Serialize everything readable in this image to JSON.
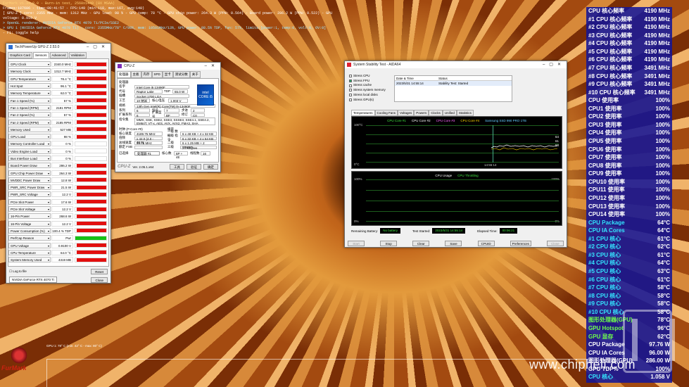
{
  "furmark": {
    "header_lines": [
      "FurMark v1.34.0.0 - Burn-in test, 2560x1440 (8X MSAA)",
      "Frames:187606 - time:00:41:57 - FPS:149 (min:118, max:167, avg:140)",
      "[ GPU-Z ] core: 2355 MHz - mem: 1312 MHz - GPU load: 98 % - GPU temp: 78 °C - GPU chip power: 264.3 W (PPW: 0.564) - Board power: 286.2 W (PPW: 0.522) - GPU voltage: 0.910 V",
      "> OpenGL renderer: NVIDIA GeForce RTX 4070 Ti/PCIe/SSE2",
      "> GPU 1 (NVIDIA GeForce RTX 4070 Ti) - core: 2355MHz/78° C/98%, mem: 10501MHz/13%, GPU power: 88.5% TDP, fan: 57%, limits:[power:1, temp:0, volt:0, OV:0]",
      "- F1: toggle help"
    ],
    "graph_label": "GPU 1: 78° C (min: 42° C - max: 80° C)",
    "logo_text": "FurMark"
  },
  "gpuz": {
    "title": "TechPowerUp GPU-Z 2.53.0",
    "tabs": [
      "Graphics Card",
      "Sensors",
      "Advanced",
      "Validation"
    ],
    "active_tab": "Sensors",
    "sensors": [
      {
        "name": "GPU Clock",
        "value": "2340.0 MHz",
        "fill": 0.95
      },
      {
        "name": "Memory Clock",
        "value": "1312.7 MHz",
        "fill": 0.95
      },
      {
        "name": "GPU Temperature",
        "value": "78.4 °C",
        "fill": 0.95
      },
      {
        "name": "Hot Spot",
        "value": "96.1 °C",
        "fill": 0.95
      },
      {
        "name": "Memory Temperature",
        "value": "62.0 °C",
        "fill": 0.95
      },
      {
        "name": "Fan 1 Speed (%)",
        "value": "57 %",
        "fill": 0.95
      },
      {
        "name": "Fan 1 Speed (RPM)",
        "value": "2181 RPM",
        "fill": 0.95
      },
      {
        "name": "Fan 2 Speed (%)",
        "value": "57 %",
        "fill": 0.95
      },
      {
        "name": "Fan 2 Speed (RPM)",
        "value": "2185 RPM",
        "fill": 0.95
      },
      {
        "name": "Memory Used",
        "value": "527 MB",
        "fill": 0.95
      },
      {
        "name": "GPU Load",
        "value": "98 %",
        "fill": 0.95
      },
      {
        "name": "Memory Controller Load",
        "value": "0 %",
        "fill": 0
      },
      {
        "name": "Video Engine Load",
        "value": "0 %",
        "fill": 0
      },
      {
        "name": "Bus Interface Load",
        "value": "0 %",
        "fill": 0
      },
      {
        "name": "Board Power Draw",
        "value": "286.2 W",
        "fill": 0.95
      },
      {
        "name": "GPU Chip Power Draw",
        "value": "264.3 W",
        "fill": 0.95
      },
      {
        "name": "MVDDC Power Draw",
        "value": "12.8 W",
        "fill": 0.95
      },
      {
        "name": "PWR_SRC Power Draw",
        "value": "21.5 W",
        "fill": 0.95
      },
      {
        "name": "PWR_SRC Voltage",
        "value": "12.2 V",
        "fill": 0.95
      },
      {
        "name": "PCIe Slot Power",
        "value": "17.6 W",
        "fill": 0.95
      },
      {
        "name": "PCIe Slot Voltage",
        "value": "12.2 V",
        "fill": 0.95
      },
      {
        "name": "16-Pin Power",
        "value": "268.6 W",
        "fill": 0.95
      },
      {
        "name": "16-Pin Voltage",
        "value": "12.2 V",
        "fill": 0.95
      },
      {
        "name": "Power Consumption (%)",
        "value": "100.4 % TDP",
        "fill": 0.95
      },
      {
        "name": "PerfCap Reason",
        "value": "Pwr",
        "fill": 1.0,
        "status": "green"
      },
      {
        "name": "GPU Voltage",
        "value": "0.9100 V",
        "fill": 0.95
      },
      {
        "name": "CPU Temperature",
        "value": "64.0 °C",
        "fill": 0.95
      },
      {
        "name": "System Memory Used",
        "value": "4319 MB",
        "fill": 0.95
      }
    ],
    "log_label": "Log to file",
    "reset_label": "Reset",
    "gpu_select": "NVIDIA GeForce RTX 4070 Ti",
    "close_label": "Close"
  },
  "cpuz": {
    "title": "CPU-Z",
    "tabs": [
      "处理器",
      "主板",
      "内存",
      "SPD",
      "显卡",
      "测试分数",
      "关于"
    ],
    "section_label": "处理器",
    "name_label": "名字",
    "name_value": "Intel Core i5 13490F",
    "codename_label": "代号",
    "codename_value": "Raptor Lake",
    "tdp_label": "TDP",
    "tdp_value": "65.0 W",
    "socket_label": "插槽",
    "socket_value": "Socket 1700 LGA",
    "tech_label": "工艺",
    "tech_value": "10 纳米",
    "vcore_label": "核心电压",
    "vcore_value": "1.003 V",
    "spec_label": "规格",
    "spec_value": "13th Gen Intel(R) Core(TM) i5-13490F",
    "family_label": "系列",
    "family_value": "6",
    "model_label": "型号",
    "model_value": "7",
    "stepping_label": "步进",
    "stepping_value": "2",
    "extfamily_label": "扩展系列",
    "extfamily_value": "6",
    "extmodel_label": "扩展型号",
    "extmodel_value": "BF",
    "revision_label": "修订",
    "revision_value": "C0",
    "instr_label": "指令集",
    "instr_value": "MMX, SSE, SSE2, SSE3, SSSE3, SSE4.1, SSE4.2, EM64T, VT-x, AES, AVX, AVX2, FMA3, SHA",
    "clocks_label": "时钟 (P-Core #0)",
    "corespeed_label": "核心速度",
    "corespeed_value": "4189.75 MHz",
    "mult_label": "倍频",
    "mult_value": "x 42.0 (4.0 - 46.0)",
    "bus_label": "总线速度",
    "bus_value": "99.76 MHz",
    "fsb_label": "额定 FSB",
    "cache_label": "缓存",
    "l1d_label": "一级 数据",
    "l1d_value": "6 x 48 KB + 4 x 32 KB",
    "l1i_label": "一级 指令",
    "l1i_value": "6 x 32 KB + 4 x 64 KB",
    "l2_label": "二级",
    "l2_value": "6 x 1.25 MB + 2 MBytes",
    "l3_label": "三级",
    "l3_value": "24 MBytes",
    "selected_label": "已选择",
    "selected_value": "处理器 #1",
    "cores_label": "核心数",
    "cores_value": "6P + 4E",
    "threads_label": "线程数",
    "threads_value": "16",
    "brand": "CPU-Z",
    "version": "Ver. 2.05.1.x64",
    "tools_label": "工具",
    "validate_label": "验证",
    "ok_label": "确定",
    "logo_text": "intel CORE i5"
  },
  "aida": {
    "title": "System Stability Test - AIDA64",
    "checks": [
      {
        "label": "Stress CPU",
        "checked": false
      },
      {
        "label": "Stress FPU",
        "checked": true
      },
      {
        "label": "Stress cache",
        "checked": false
      },
      {
        "label": "Stress system memory",
        "checked": false
      },
      {
        "label": "Stress local disks",
        "checked": false
      },
      {
        "label": "Stress GPU(s)",
        "checked": false
      }
    ],
    "info_headers": [
      "Date & Time",
      "Status"
    ],
    "info_row": [
      "2023/5/31 14:55:14",
      "Stability Test: Started"
    ],
    "tabs": [
      "Temperatures",
      "Cooling Fans",
      "Voltages",
      "Powers",
      "Clocks",
      "Unified",
      "Statistics"
    ],
    "active_tab": "Temperatures",
    "temp_legend": [
      "CPU Core #1",
      "CPU Core #2",
      "CPU Core #3",
      "CPU Core #4",
      "Samsung SSD 990 PRO 1TB"
    ],
    "temp_ymax": "100°C",
    "temp_ymin": "0°C",
    "temp_time": "14:55:14",
    "temp_readouts": [
      "64",
      "61",
      "58"
    ],
    "usage_legend_a": "CPU Usage",
    "usage_legend_b": "CPU Throttling",
    "usage_ymax": "100%",
    "usage_ymin": "0%",
    "usage_rmax": "100%",
    "usage_rmin": "0%",
    "battery_label": "Remaining Battery:",
    "battery_value": "No battery",
    "started_label": "Test Started:",
    "started_value": "2023/5/31 14:55:14",
    "elapsed_label": "Elapsed Time:",
    "elapsed_value": "00:06:21",
    "buttons": [
      "Start",
      "Stop",
      "Clear",
      "Save",
      "CPUID",
      "Preferences",
      "Close"
    ]
  },
  "osd": {
    "rows": [
      {
        "k": "CPU 核心频率",
        "v": "4190 MHz",
        "c": "white"
      },
      {
        "k": "#1 CPU 核心频率",
        "v": "4190 MHz",
        "c": "white"
      },
      {
        "k": "#2 CPU 核心频率",
        "v": "4190 MHz",
        "c": "white"
      },
      {
        "k": "#3 CPU 核心频率",
        "v": "4190 MHz",
        "c": "white"
      },
      {
        "k": "#4 CPU 核心频率",
        "v": "4190 MHz",
        "c": "white"
      },
      {
        "k": "#5 CPU 核心频率",
        "v": "4190 MHz",
        "c": "white"
      },
      {
        "k": "#6 CPU 核心频率",
        "v": "4190 MHz",
        "c": "white"
      },
      {
        "k": "#7 CPU 核心频率",
        "v": "3491 MHz",
        "c": "white"
      },
      {
        "k": "#8 CPU 核心频率",
        "v": "3491 MHz",
        "c": "white"
      },
      {
        "k": "#9 CPU 核心频率",
        "v": "3491 MHz",
        "c": "white"
      },
      {
        "k": "#10 CPU 核心频率",
        "v": "3491 MHz",
        "c": "white"
      },
      {
        "k": "CPU 使用率",
        "v": "100%",
        "c": "white"
      },
      {
        "k": "CPU1 使用率",
        "v": "100%",
        "c": "white"
      },
      {
        "k": "CPU2 使用率",
        "v": "100%",
        "c": "white"
      },
      {
        "k": "CPU3 使用率",
        "v": "100%",
        "c": "white"
      },
      {
        "k": "CPU4 使用率",
        "v": "100%",
        "c": "white"
      },
      {
        "k": "CPU5 使用率",
        "v": "100%",
        "c": "white"
      },
      {
        "k": "CPU6 使用率",
        "v": "100%",
        "c": "white"
      },
      {
        "k": "CPU7 使用率",
        "v": "100%",
        "c": "white"
      },
      {
        "k": "CPU8 使用率",
        "v": "100%",
        "c": "white"
      },
      {
        "k": "CPU9 使用率",
        "v": "100%",
        "c": "white"
      },
      {
        "k": "CPU10 使用率",
        "v": "100%",
        "c": "white"
      },
      {
        "k": "CPU11 使用率",
        "v": "100%",
        "c": "white"
      },
      {
        "k": "CPU12 使用率",
        "v": "100%",
        "c": "white"
      },
      {
        "k": "CPU13 使用率",
        "v": "100%",
        "c": "white"
      },
      {
        "k": "CPU14 使用率",
        "v": "100%",
        "c": "white"
      },
      {
        "k": "CPU Package",
        "v": "64°C",
        "c": "cyan"
      },
      {
        "k": "CPU IA Cores",
        "v": "64°C",
        "c": "cyan"
      },
      {
        "k": "#1 CPU 核心",
        "v": "61°C",
        "c": "cyan"
      },
      {
        "k": "#2 CPU 核心",
        "v": "62°C",
        "c": "cyan"
      },
      {
        "k": "#3 CPU 核心",
        "v": "61°C",
        "c": "cyan"
      },
      {
        "k": "#4 CPU 核心",
        "v": "64°C",
        "c": "cyan"
      },
      {
        "k": "#5 CPU 核心",
        "v": "63°C",
        "c": "cyan"
      },
      {
        "k": "#6 CPU 核心",
        "v": "61°C",
        "c": "cyan"
      },
      {
        "k": "#7 CPU 核心",
        "v": "58°C",
        "c": "cyan"
      },
      {
        "k": "#8 CPU 核心",
        "v": "58°C",
        "c": "cyan"
      },
      {
        "k": "#9 CPU 核心",
        "v": "58°C",
        "c": "cyan"
      },
      {
        "k": "#10 CPU 核心",
        "v": "58°C",
        "c": "cyan"
      },
      {
        "k": "图形处理器(GPU)",
        "v": "78°C",
        "c": "green"
      },
      {
        "k": "GPU Hotspot",
        "v": "96°C",
        "c": "green"
      },
      {
        "k": "GPU 显存",
        "v": "62°C",
        "c": "green"
      },
      {
        "k": "CPU Package",
        "v": "97.76 W",
        "c": "white"
      },
      {
        "k": "CPU IA Cores",
        "v": "96.00 W",
        "c": "white"
      },
      {
        "k": "图形处理器(GPU)",
        "v": "286.00 W",
        "c": "white"
      },
      {
        "k": "GPU TDP%",
        "v": "100%",
        "c": "white"
      },
      {
        "k": "CPU 核心",
        "v": "1.058 V",
        "c": "cyan"
      }
    ]
  },
  "watermark": "www.chiphell.com"
}
